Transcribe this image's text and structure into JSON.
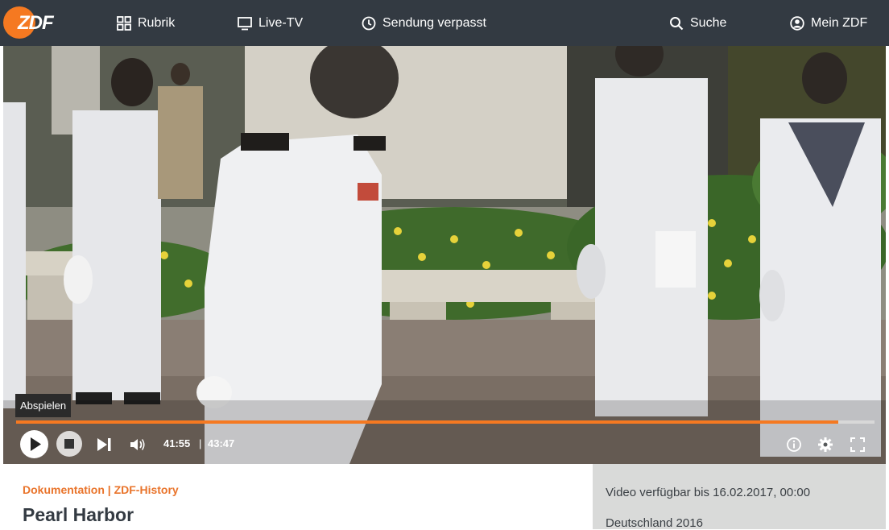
{
  "colors": {
    "topbar_bg": "#333a42",
    "brand_orange": "#f57921",
    "category_orange": "#e9742b",
    "info_panel_bg": "#d9dad9"
  },
  "header": {
    "logo_text": "ZDF",
    "nav": [
      {
        "icon": "grid-icon",
        "label": "Rubrik"
      },
      {
        "icon": "tv-icon",
        "label": "Live-TV"
      },
      {
        "icon": "clock-icon",
        "label": "Sendung verpasst"
      },
      {
        "icon": "search-icon",
        "label": "Suche"
      },
      {
        "icon": "user-icon",
        "label": "Mein ZDF"
      }
    ]
  },
  "player": {
    "tooltip": "Abspielen",
    "progress_fraction": 0.958,
    "current_time": "41:55",
    "time_separator": "|",
    "duration": "43:47",
    "controls": [
      "play-icon",
      "stop-icon",
      "skip-next-icon",
      "volume-icon",
      "info-icon",
      "gear-icon",
      "fullscreen-icon"
    ]
  },
  "info": {
    "category": "Dokumentation | ZDF-History",
    "title": "Pearl Harbor",
    "availability": "Video verfügbar bis 16.02.2017, 00:00",
    "country_year": "Deutschland 2016"
  }
}
